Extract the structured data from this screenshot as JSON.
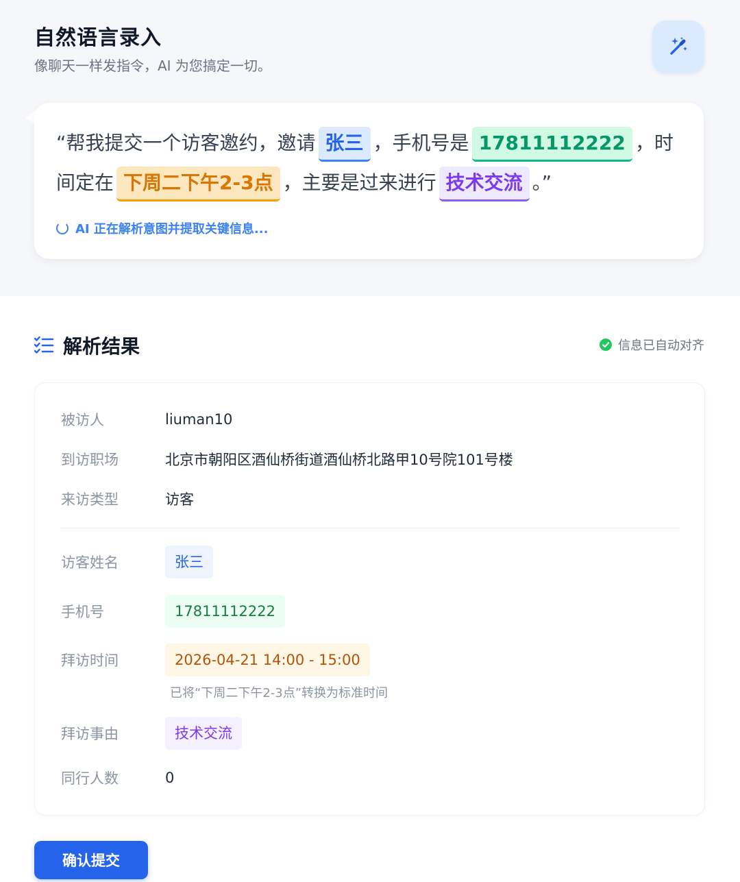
{
  "header": {
    "title": "自然语言录入",
    "subtitle": "像聊天一样发指令，AI 为您搞定一切。",
    "magic_icon": "magic-wand-icon"
  },
  "utterance": {
    "open_quote": "“",
    "part1": "帮我提交一个访客邀约，邀请",
    "entity_name": "张三",
    "part2": "，手机号是",
    "entity_phone": "17811112222",
    "part3": "，时间定在",
    "entity_time": "下周二下午2-3点",
    "part4": "，主要是过来进行",
    "entity_reason": "技术交流",
    "part5": "。",
    "close_quote": "”",
    "parsing_status": "AI 正在解析意图并提取关键信息..."
  },
  "result": {
    "title": "解析结果",
    "aligned_text": "信息已自动对齐",
    "fields": {
      "host_label": "被访人",
      "host_value": "liuman10",
      "site_label": "到访职场",
      "site_value": "北京市朝阳区酒仙桥街道酒仙桥北路甲10号院101号楼",
      "type_label": "来访类型",
      "type_value": "访客",
      "visitor_label": "访客姓名",
      "visitor_value": "张三",
      "phone_label": "手机号",
      "phone_value": "17811112222",
      "time_label": "拜访时间",
      "time_value": "2026-04-21 14:00 - 15:00",
      "time_hint": "已将“下周二下午2-3点”转换为标准时间",
      "reason_label": "拜访事由",
      "reason_value": "技术交流",
      "companions_label": "同行人数",
      "companions_value": "0"
    }
  },
  "actions": {
    "submit_label": "确认提交"
  },
  "colors": {
    "primary": "#2563eb",
    "success": "#22c55e",
    "name_chip": "#dbeafe",
    "phone_chip": "#d1fae5",
    "time_chip": "#fde7bf",
    "reason_chip": "#ede9fe"
  }
}
